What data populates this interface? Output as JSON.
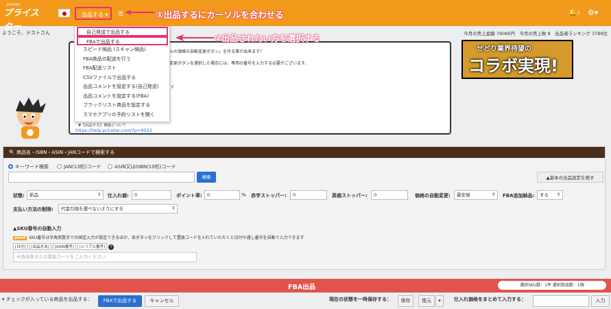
{
  "header": {
    "logo_small": "pricetar",
    "logo": "プライスター",
    "menu_listing": "出品する ▾",
    "menu_next": "出",
    "annotation1": "①出品するにカーソルを合わせる",
    "bell_count": "3",
    "accent_color": "#f39a1d",
    "highlight_color": "#e8336a"
  },
  "info": {
    "welcome": "ようこそ、テストさん",
    "stats": "今月の売上金額 79086円　今月の売上数 8　出品者ランキング 3789位"
  },
  "dropdown": {
    "items": [
      "自己発送で出品する",
      "FBAで出品する",
      "スピード納品 (スキャン納品)",
      "FBA商品の配送を行う",
      "FBA配送リスト",
      "CSVファイルで出品する",
      "出品コメントを設定する(自己発送)",
      "出品コメントを設定する(FBA)",
      "ブラックリスト商品を設定する",
      "スマホアプリの予約リストを開く"
    ],
    "annotation2": "②出品されたい方を選択する"
  },
  "bubble": {
    "text1": "ルの価格の自動変更ボタン」を作る事が出来ます！",
    "text2": "変更ボタンを選択した場合には、専用の番号を入力する必要がございます。",
    "text3": "F",
    "note": "▼【出品する】機能について",
    "link": "https://help.pricetar.com/?p=9022"
  },
  "banner": {
    "line1": "せどり業界待望の",
    "line2": "コラボ実現!"
  },
  "search": {
    "heading": "商品名・ISBN・ASIN・JANコードで検索する",
    "radio_keyword": "キーワード検索",
    "radio_jan": "JAN(13桁)コード",
    "radio_asin": "ASIN又はISBN(10桁)コード",
    "search_button": "検索",
    "hide_button": "▲基本の出品設定を隠す"
  },
  "settings": {
    "condition_label": "状態:",
    "condition_value": "新品",
    "cost_label": "仕入れ値:",
    "cost_value": "0",
    "point_label": "ポイント率:",
    "point_value": "0",
    "percent": "%",
    "red_stopper_label": "赤字ストッパー:",
    "red_stopper_value": "0",
    "high_stopper_label": "高値ストッパー:",
    "high_stopper_value": "0",
    "auto_price_label": "価格の自動変更:",
    "auto_price_value": "最安値",
    "fba_add_label": "FBA追加納品:",
    "fba_add_value": "する",
    "payment_label": "支払い方法の制限:",
    "payment_value": "代金引換を選べないようにする"
  },
  "sku": {
    "heading": "▲SKU番号の自動入力",
    "point_badge": "point",
    "point_text": "SKU番号は半角英数字での固定入力が設定できるほか、各ボタンをクリックして置換コードを入れていただくと日付や通し番号を自動で入力できます",
    "tags": [
      "[日付]",
      "[出品方法]",
      "[ASIN番号]",
      "[シリアル番号]"
    ],
    "input_placeholder": "半角英数または置換コードをご入力ください"
  },
  "fba": {
    "title": "FBA出品",
    "count": "選択SKU数：1件 選択商品数：1個"
  },
  "footer": {
    "checked_label": "▾ チェックが入っている商品を出品する：",
    "fba_button": "FBAで出品する",
    "cancel_button": "キャンセル",
    "save_state_label": "現在の状態を一時保存する：",
    "save_button": "保存",
    "restore_button": "復元",
    "bulk_cost_label": "仕入れ価格をまとめて入力する：",
    "input_button": "入力"
  }
}
